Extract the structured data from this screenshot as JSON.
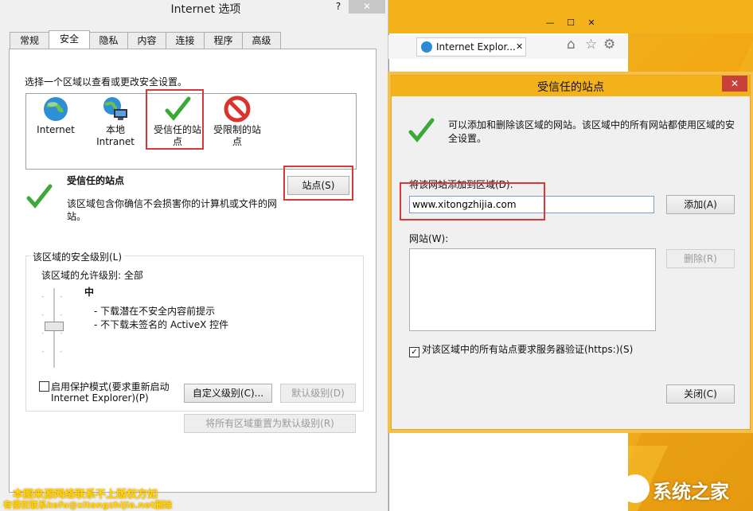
{
  "left_dialog": {
    "title": "Internet 选项",
    "help": "?",
    "close": "✕",
    "tabs": [
      "常规",
      "安全",
      "隐私",
      "内容",
      "连接",
      "程序",
      "高级"
    ],
    "instruction": "选择一个区域以查看或更改安全设置。",
    "zones": [
      {
        "label": "Internet"
      },
      {
        "label": "本地\nIntranet"
      },
      {
        "label": "受信任的站\n点"
      },
      {
        "label": "受限制的站\n点"
      }
    ],
    "selected_zone_title": "受信任的站点",
    "selected_zone_desc": "该区域包含你确信不会损害你的计算机或文件的网站。",
    "sites_button": "站点(S)",
    "security_level_group": "该区域的安全级别(L)",
    "allowed_levels": "该区域的允许级别: 全部",
    "level_name": "中",
    "level_bullets": [
      "- 下载潜在不安全内容前提示",
      "- 不下载未签名的 ActiveX 控件"
    ],
    "protected_mode_line1": "启用保护模式(要求重新启动",
    "protected_mode_line2": "Internet Explorer)(P)",
    "custom_level_button": "自定义级别(C)...",
    "default_level_button": "默认级别(D)",
    "reset_all_button": "将所有区域重置为默认级别(R)"
  },
  "browser": {
    "tab_title": "Internet Explor...",
    "tab_close": "✕",
    "min": "—",
    "max": "☐",
    "close": "✕"
  },
  "right_dialog": {
    "title": "受信任的站点",
    "close": "✕",
    "info": "可以添加和删除该区域的网站。该区域中的所有网站都使用区域的安全设置。",
    "add_label": "将该网站添加到区域(D):",
    "add_value": "www.xitongzhijia.com",
    "add_button": "添加(A)",
    "websites_label": "网站(W):",
    "remove_button": "删除(R)",
    "require_https": "对该区域中的所有站点要求服务器验证(https:)(S)",
    "close_button": "关闭(C)"
  },
  "watermark": {
    "line1": "本图来源网络联系不上版权方如",
    "line2": "有侵权联系kefu@xitongzhijia.net删除",
    "logo": "系统之家"
  },
  "colors": {
    "accent_red": "#d9383a",
    "check_green": "#3aa935",
    "dialog_border": "#e8a823"
  }
}
